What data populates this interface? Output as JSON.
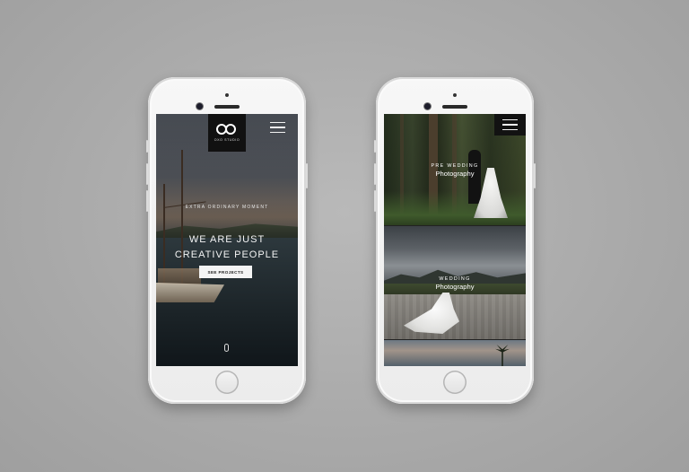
{
  "phone_left": {
    "logo": {
      "caption": "OXO STUDIO",
      "icon": "infinity-rings-icon"
    },
    "menu_icon": "hamburger-menu-icon",
    "hero": {
      "tagline": "EXTRA ORDINARY MOMENT",
      "headline_line1": "WE ARE JUST",
      "headline_line2": "CREATIVE PEOPLE",
      "cta_label": "SEE PROJECTS"
    },
    "scroll_icon": "scroll-mouse-icon"
  },
  "phone_right": {
    "menu_icon": "hamburger-menu-icon",
    "categories": [
      {
        "upper": "PRE WEDDING",
        "lower": "Photography"
      },
      {
        "upper": "WEDDING",
        "lower": "Photography"
      }
    ]
  }
}
